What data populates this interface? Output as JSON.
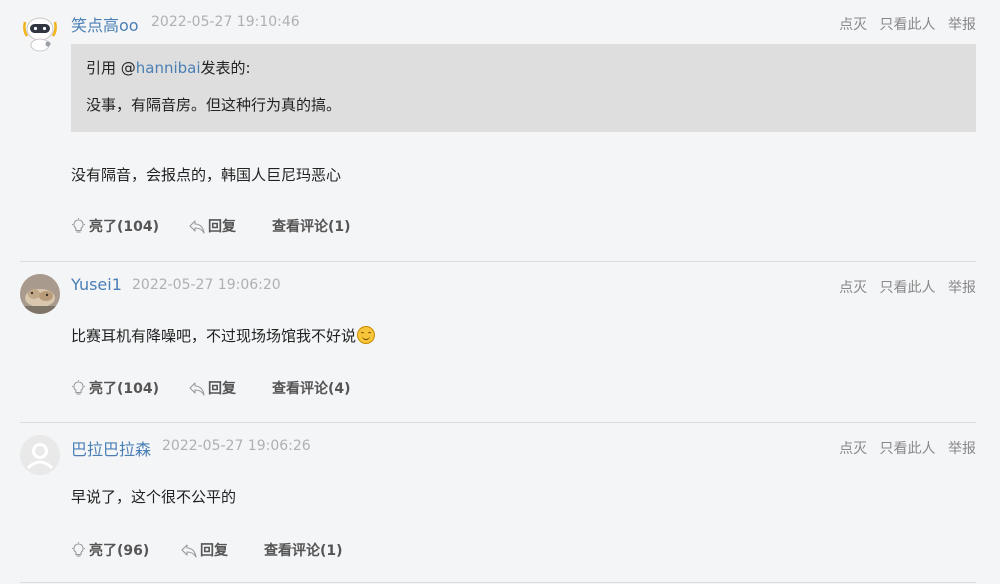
{
  "comments": [
    {
      "username": "笑点高oo",
      "time": "2022-05-27 19:10:46",
      "avatar": "robot-avatar",
      "quote": {
        "prefix": "引用 @",
        "mention": "hannibai",
        "suffix": "发表的:",
        "text": "没事，有隔音房。但这种行为真的搞。"
      },
      "content": "没有隔音，会报点的，韩国人巨尼玛恶心",
      "actions": {
        "like": "亮了(104)",
        "reply": "回复",
        "view": "查看评论(1)"
      },
      "side": {
        "dislike": "点灭",
        "only": "只看此人",
        "report": "举报"
      }
    },
    {
      "username": "Yusei1",
      "time": "2022-05-27 19:06:20",
      "avatar": "photo-avatar",
      "content": "比赛耳机有降噪吧，不过现场场馆我不好说",
      "emoji": "hug-emoji",
      "actions": {
        "like": "亮了(104)",
        "reply": "回复",
        "view": "查看评论(4)"
      },
      "side": {
        "dislike": "点灭",
        "only": "只看此人",
        "report": "举报"
      }
    },
    {
      "username": "巴拉巴拉森",
      "time": "2022-05-27 19:06:26",
      "avatar": "default-user-avatar",
      "content": "早说了，这个很不公平的",
      "actions": {
        "like": "亮了(96)",
        "reply": "回复",
        "view": "查看评论(1)"
      },
      "side": {
        "dislike": "点灭",
        "only": "只看此人",
        "report": "举报"
      }
    }
  ],
  "colors": {
    "username": "#4a7fb5",
    "quote_bg": "#dedede",
    "page_bg": "#f4f5f7"
  }
}
